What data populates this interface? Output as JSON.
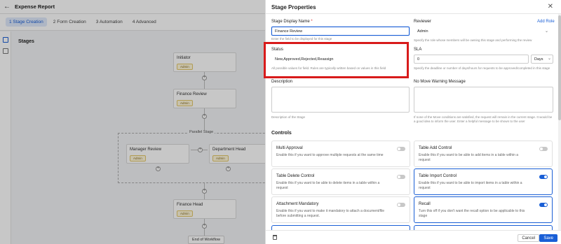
{
  "app": {
    "title": "Expense Report",
    "tabs": [
      "1 Stage Creation",
      "2 Form Creation",
      "3 Automation",
      "4 Advanced"
    ],
    "stages_title": "Stages",
    "nodes": {
      "initiator": {
        "label": "Initiator",
        "badge": "Admin"
      },
      "finance_review": {
        "label": "Finance Review",
        "badge": "Admin"
      },
      "manager_review": {
        "label": "Manager Review",
        "badge": "Admin"
      },
      "department_head": {
        "label": "Department Head",
        "badge": "Admin"
      },
      "finance_head": {
        "label": "Finance Head",
        "badge": "Admin"
      }
    },
    "parallel_label": "Parallel Stage",
    "end_label": "End of Workflow"
  },
  "panel": {
    "title": "Stage Properties",
    "stage_name": {
      "label": "Stage Display Name",
      "required_mark": "*",
      "value": "Finance Review",
      "help": "Enter the field to be displayed for this stage"
    },
    "reviewer": {
      "label": "Reviewer",
      "add_role": "Add Role",
      "value": "Admin",
      "help": "Specify the role whose members will be owning this stage and performing the review"
    },
    "status": {
      "label": "Status",
      "value": "New,Approved,Rejected,Reassign",
      "help": "All possible values for field. Rules are typically written based on values in this field"
    },
    "sla": {
      "label": "SLA",
      "value": "0",
      "unit": "Days",
      "help": "Specify the deadline or number of days/hours for requests to be approved/completed in this stage"
    },
    "description": {
      "label": "Description",
      "help": "Description of the Stage"
    },
    "no_move": {
      "label": "No Move Warning Message",
      "help": "If none of the Move conditions are satisfied, the request will remain in the current stage. It would be a good idea to inform the user. Enter a helpful message to be shown to the user"
    },
    "controls_title": "Controls",
    "controls": [
      {
        "title": "Multi Approval",
        "desc": "Enable this if you want to approve multiple requests at the same time",
        "on": false
      },
      {
        "title": "Table Add Control",
        "desc": "Enable this if you want to be able to add items in a table within a request",
        "on": false
      },
      {
        "title": "Table Delete Control",
        "desc": "Enable this if you want to be able to delete items in a table within a request",
        "on": false
      },
      {
        "title": "Table Import Control",
        "desc": "Enable this if you want to be able to import items in a table within a request",
        "on": true
      },
      {
        "title": "Attachment Mandatory",
        "desc": "Enable this if you want to make it mandatory to attach a document/file before submitting a request.",
        "on": false
      },
      {
        "title": "Recall",
        "desc": "Turn this off if you don't want the recall option to be applicable to this stage",
        "on": true
      }
    ],
    "cancel_label": "Cancel",
    "save_label": "Save"
  }
}
